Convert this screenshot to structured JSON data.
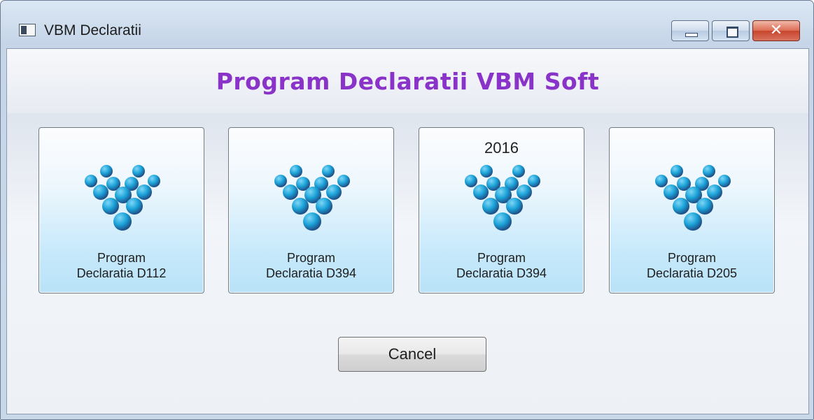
{
  "window": {
    "title": "VBM Declaratii"
  },
  "titlebar": {
    "minimize_icon": "minimize-icon",
    "maximize_icon": "maximize-icon",
    "close_icon": "close-icon",
    "close_glyph": "✕"
  },
  "header": {
    "title": "Program Declaratii VBM Soft"
  },
  "tiles": [
    {
      "year": "",
      "line1": "Program",
      "line2": "Declaratia D112",
      "icon": "vbm-logo-icon"
    },
    {
      "year": "",
      "line1": "Program",
      "line2": "Declaratia D394",
      "icon": "vbm-logo-icon"
    },
    {
      "year": "2016",
      "line1": "Program",
      "line2": "Declaratia D394",
      "icon": "vbm-logo-icon"
    },
    {
      "year": "",
      "line1": "Program",
      "line2": "Declaratia D205",
      "icon": "vbm-logo-icon"
    }
  ],
  "footer": {
    "cancel_label": "Cancel"
  },
  "colors": {
    "accent": "#8a33c9",
    "logo_dark": "#1f4f86",
    "logo_light": "#1aa2d8"
  }
}
